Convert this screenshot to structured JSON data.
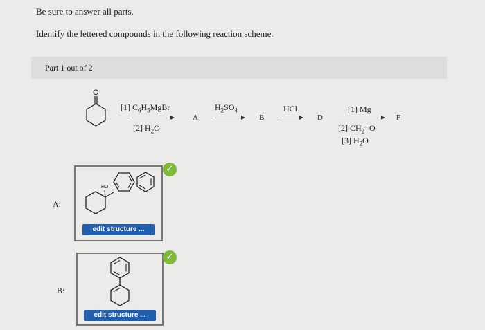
{
  "instructions": {
    "line1": "Be sure to answer all parts.",
    "line2": "Identify the lettered compounds in the following reaction scheme."
  },
  "part": {
    "label": "Part 1 out of 2"
  },
  "scheme": {
    "starting_material": "cyclohexanone",
    "step1": {
      "reagent_top": "[1] C6H5MgBr",
      "reagent_bottom": "[2] H2O",
      "product": "A"
    },
    "step2": {
      "reagent_top": "H2SO4",
      "product": "B"
    },
    "step3": {
      "reagent_top": "HCl",
      "product": "D"
    },
    "step4": {
      "reagent_top": "[1] Mg",
      "reagent_bottom_1": "[2] CH2=O",
      "reagent_bottom_2": "[3] H2O",
      "product": "F"
    }
  },
  "answers": [
    {
      "label": "A:",
      "structure_text": "HO",
      "button": "edit structure ...",
      "status": "correct"
    },
    {
      "label": "B:",
      "button": "edit structure ...",
      "status": "correct"
    }
  ],
  "colors": {
    "button": "#1f5fae",
    "check": "#7fba3b",
    "background": "#ecebe9"
  }
}
